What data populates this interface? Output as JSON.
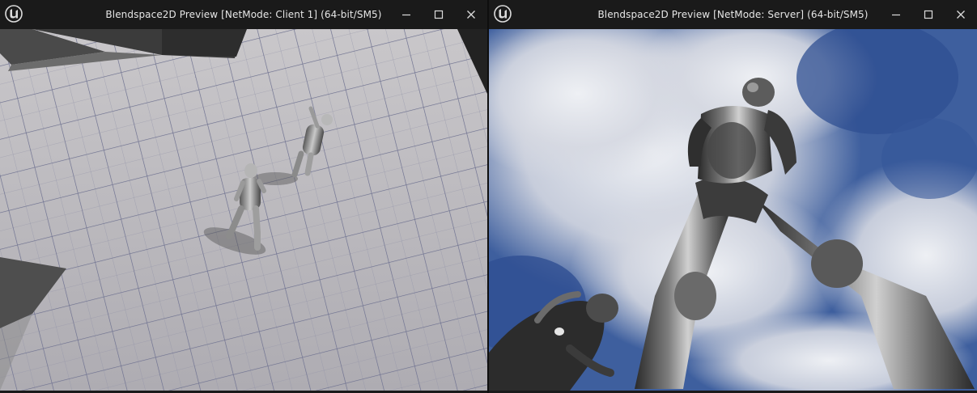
{
  "windows": [
    {
      "title": "Blendspace2D Preview [NetMode: Client 1]  (64-bit/SM5)",
      "logo_icon": "unreal-engine-logo",
      "controls": [
        "minimize-icon",
        "maximize-icon",
        "close-icon"
      ]
    },
    {
      "title": "Blendspace2D Preview [NetMode: Server]  (64-bit/SM5)",
      "logo_icon": "unreal-engine-logo",
      "controls": [
        "minimize-icon",
        "maximize-icon",
        "close-icon"
      ]
    }
  ],
  "colors": {
    "titlebar_bg": "#1a1a1a",
    "title_text": "#e6e6e6",
    "floor": "#b9b7bb",
    "grid_line": "#7c7f9a",
    "sky": "#3e5f9e",
    "cloud": "#e4e6ec",
    "mannequin": "#8a8a8a"
  }
}
